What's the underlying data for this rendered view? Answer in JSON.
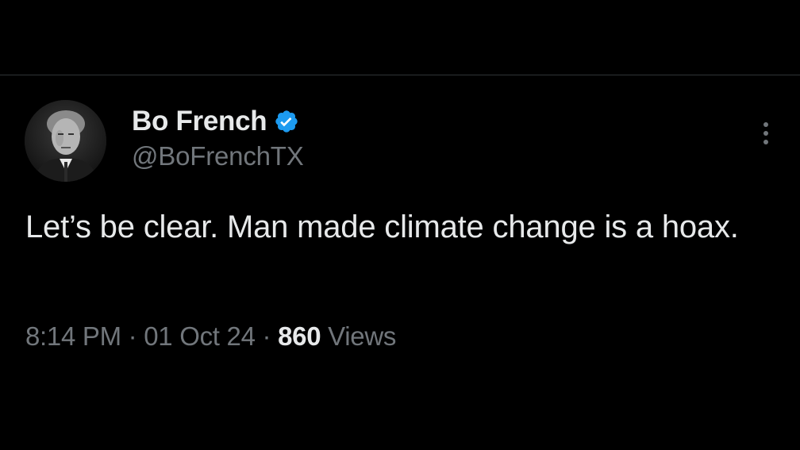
{
  "author": {
    "display_name": "Bo French",
    "handle": "@BoFrenchTX",
    "verified": true,
    "avatar_icon": "profile-photo"
  },
  "tweet": {
    "text": "Let’s be clear. Man made climate change is a hoax.",
    "time": "8:14 PM",
    "date": "01 Oct 24",
    "separator": "·",
    "views_count": "860",
    "views_label": "Views"
  },
  "icons": {
    "verified_badge": "verified-badge-icon",
    "more": "more-vertical-icon"
  },
  "colors": {
    "background": "#000000",
    "primary_text": "#e7e9ea",
    "secondary_text": "#71767b",
    "verified_blue": "#1d9bf0",
    "divider": "#2f3336"
  }
}
